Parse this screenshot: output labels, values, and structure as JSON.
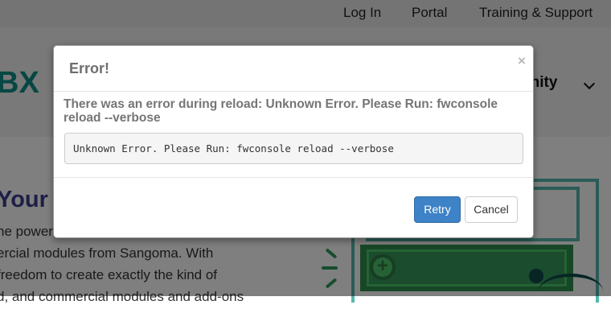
{
  "topbar": {
    "links": [
      "Log In",
      "Portal",
      "Training & Support"
    ]
  },
  "navbar": {
    "logo_text": "BX",
    "community_label": "unity"
  },
  "hero": {
    "title": "Your F",
    "lines": [
      "he power",
      "ercial modules from Sangoma. With",
      "freedom to create exactly the kind of",
      "d, and commercial modules and add-ons"
    ]
  },
  "modal": {
    "title": "Error!",
    "close_glyph": "×",
    "heading": "There was an error during reload: Unknown Error. Please Run: fwconsole reload --verbose",
    "code_text": "Unknown Error. Please Run: fwconsole reload --verbose",
    "retry_label": "Retry",
    "cancel_label": "Cancel"
  },
  "colors": {
    "retry_button": "#3e82c7",
    "brand_teal": "#0f8f87",
    "overlay": "rgba(0,0,0,0.5)"
  }
}
